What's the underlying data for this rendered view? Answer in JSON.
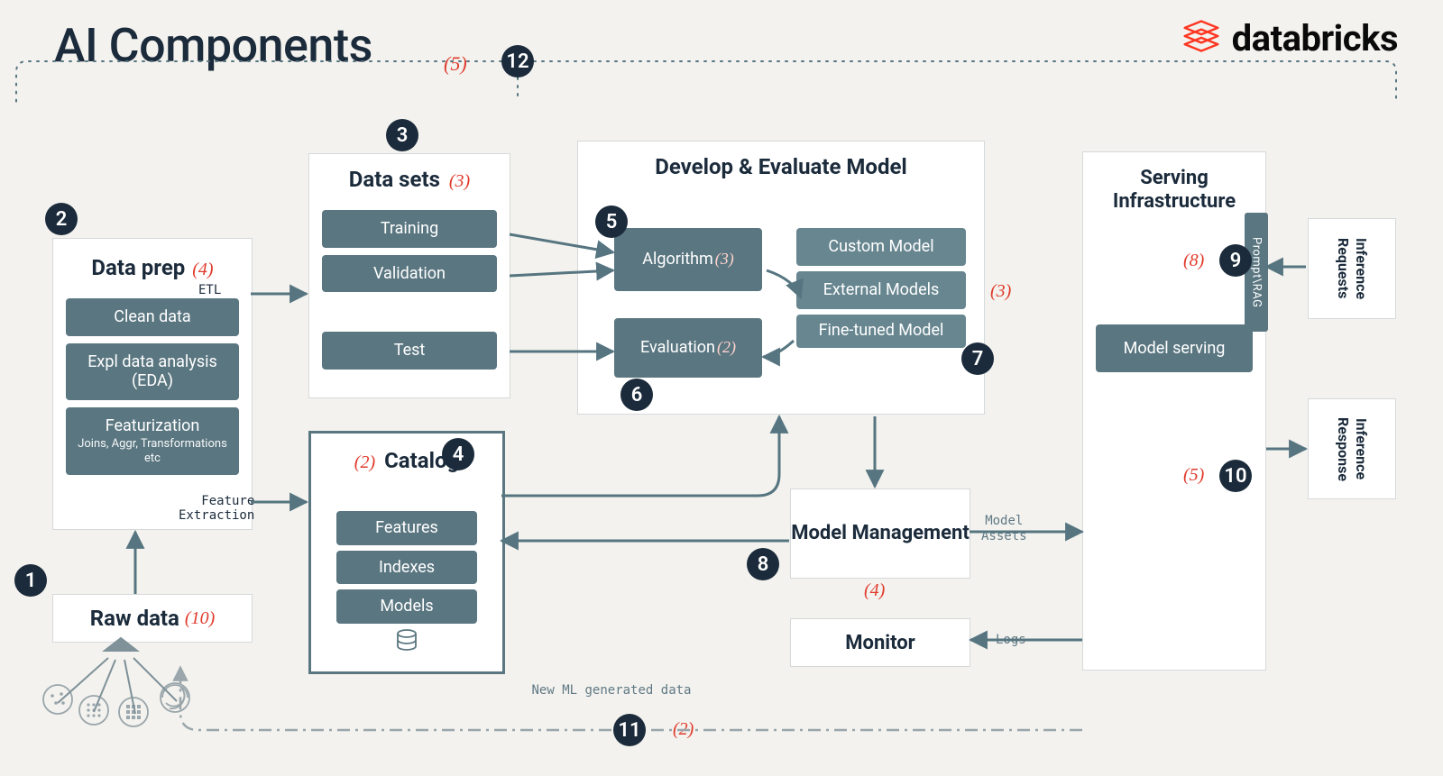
{
  "title": "AI Components",
  "brand": {
    "name": "databricks",
    "accent": "#ff3621"
  },
  "badges": {
    "n1": "1",
    "n2": "2",
    "n3": "3",
    "n4": "4",
    "n5": "5",
    "n6": "6",
    "n7": "7",
    "n8": "8",
    "n9": "9",
    "n10": "10",
    "n11": "11",
    "n12": "12"
  },
  "top_count": "(5)",
  "raw_data": {
    "title": "Raw data",
    "count": "(10)"
  },
  "data_prep": {
    "title": "Data prep",
    "count": "(4)",
    "etl_label": "ETL",
    "items": [
      "Clean data",
      "Expl data analysis (EDA)"
    ],
    "featurization": {
      "title": "Featurization",
      "sub": "Joins, Aggr, Transformations etc"
    },
    "feat_extraction_label": "Feature\nExtraction"
  },
  "data_sets": {
    "title": "Data sets",
    "count": "(3)",
    "items": [
      "Training",
      "Validation",
      "Test"
    ]
  },
  "catalog": {
    "title": "Catalog",
    "count": "(2)",
    "items": [
      "Features",
      "Indexes",
      "Models"
    ]
  },
  "develop_eval": {
    "title": "Develop & Evaluate Model",
    "algorithm": {
      "label": "Algorithm",
      "count": "(3)"
    },
    "evaluation": {
      "label": "Evaluation",
      "count": "(2)"
    },
    "models": {
      "custom": "Custom Model",
      "external": "External Models",
      "external_count": "(3)",
      "finetuned": "Fine-tuned Model"
    }
  },
  "model_mgmt": {
    "title": "Model Management",
    "count": "(4)",
    "assets_label": "Model\nAssets"
  },
  "monitor": {
    "title": "Monitor",
    "logs_label": "Logs"
  },
  "serving": {
    "title": "Serving Infrastructure",
    "prompt_rag": "Prompt\\RAG",
    "model_serving": "Model serving",
    "count9": "(8)",
    "count10": "(5)"
  },
  "inference": {
    "requests": "Inference Requests",
    "response": "Inference Response"
  },
  "new_data_label": "New ML generated data",
  "new_data_count": "(2)"
}
